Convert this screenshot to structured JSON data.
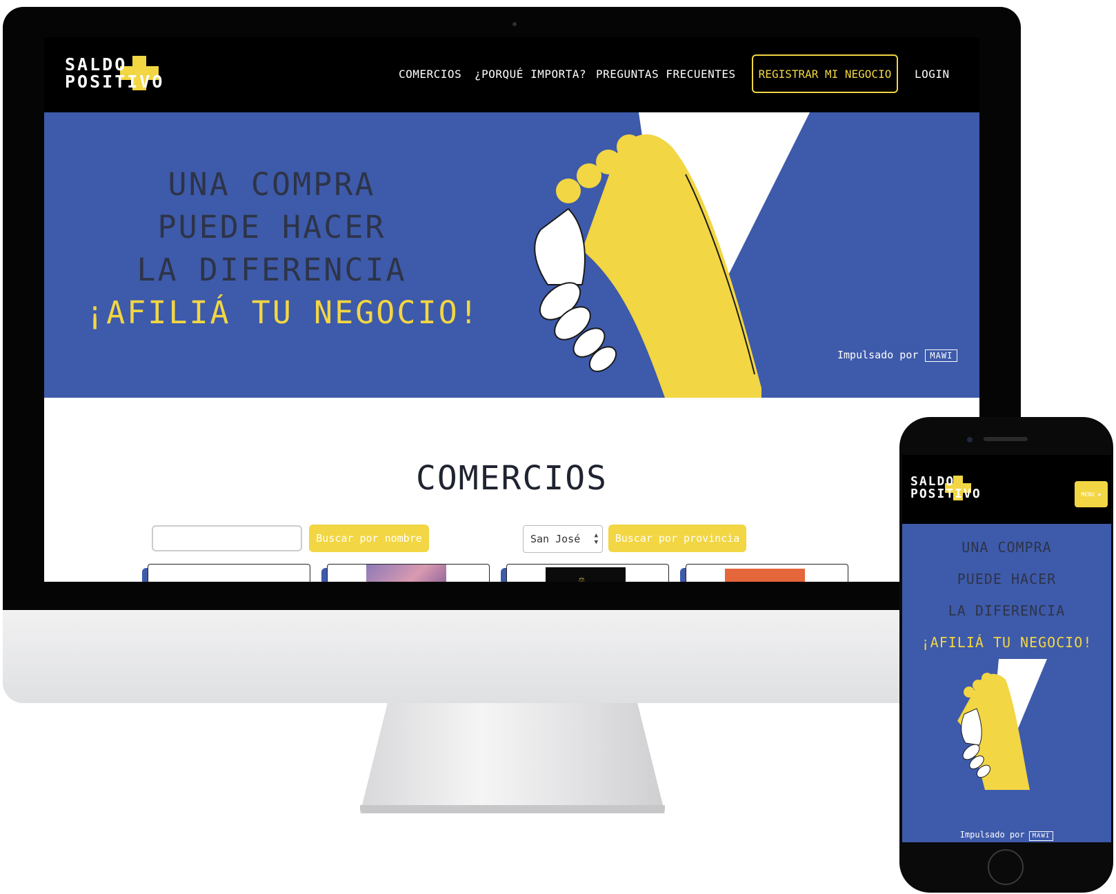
{
  "brand": {
    "line1": "SALDO",
    "line2": "POSITIVO",
    "accent_color": "#f2d643",
    "primary_color": "#3e5aaa"
  },
  "nav": {
    "items": [
      {
        "label": "COMERCIOS"
      },
      {
        "label": "¿PORQUÉ IMPORTA?"
      },
      {
        "label": "PREGUNTAS FRECUENTES"
      }
    ],
    "cta_label": "REGISTRAR MI NEGOCIO",
    "login_label": "LOGIN"
  },
  "hero": {
    "lines": [
      "UNA COMPRA",
      "PUEDE HACER",
      "LA DIFERENCIA"
    ],
    "cta": "¡AFILIÁ TU NEGOCIO!",
    "powered_label": "Impulsado por",
    "powered_brand": "MAWI"
  },
  "comercios": {
    "title": "COMERCIOS",
    "search_value": "",
    "search_button": "Buscar por nombre",
    "province_selected": "San José",
    "province_button": "Buscar por provincia"
  },
  "mobile": {
    "menu_label": "MENU ≡"
  }
}
